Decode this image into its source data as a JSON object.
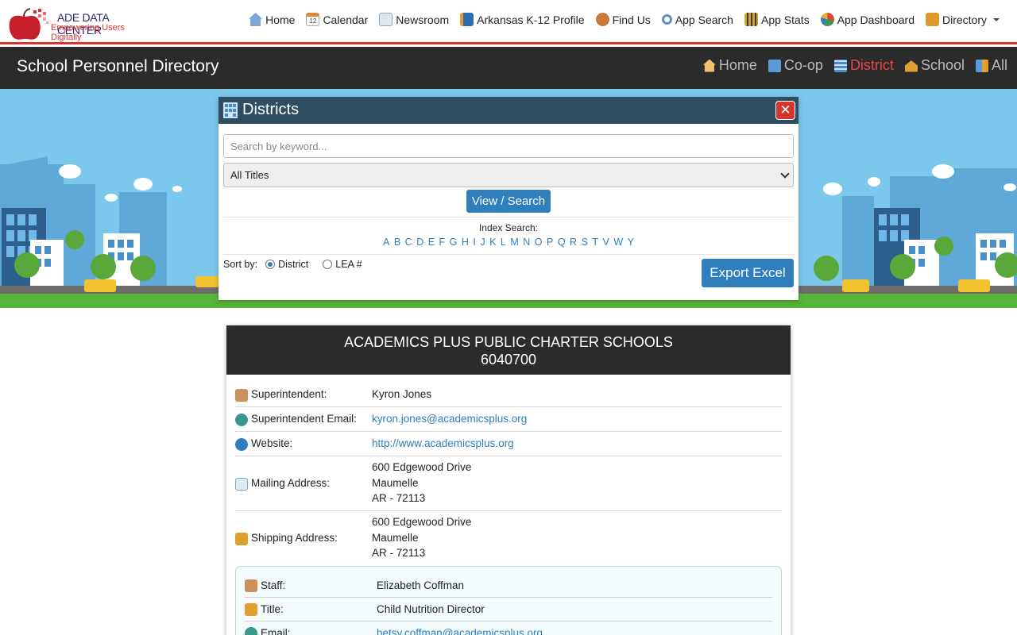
{
  "brand": {
    "title": "ADE DATA CENTER",
    "subtitle": "Empowering Users Digitally"
  },
  "topnav": [
    {
      "label": "Home",
      "icon": "house-icon",
      "color": "#7aa7d6"
    },
    {
      "label": "Calendar",
      "icon": "calendar-icon",
      "color": "#e0883a"
    },
    {
      "label": "Newsroom",
      "icon": "newspaper-icon",
      "color": "#8aa4b8"
    },
    {
      "label": "Arkansas K-12 Profile",
      "icon": "book-icon",
      "color": "#2f6fb0"
    },
    {
      "label": "Find Us",
      "icon": "person-icon",
      "color": "#c87a3a"
    },
    {
      "label": "App Search",
      "icon": "magnifier-icon",
      "color": "#5a8fc4"
    },
    {
      "label": "App Stats",
      "icon": "bar-chart-icon",
      "color": "#c9a23a"
    },
    {
      "label": "App Dashboard",
      "icon": "pie-chart-icon",
      "color": "#d94a3a"
    },
    {
      "label": "Directory",
      "icon": "address-book-icon",
      "color": "#e09a2a"
    }
  ],
  "header": {
    "title": "School Personnel Directory"
  },
  "subnav": [
    {
      "label": "Home",
      "icon": "house-icon",
      "active": false
    },
    {
      "label": "Co-op",
      "icon": "building-icon",
      "active": false
    },
    {
      "label": "District",
      "icon": "office-building-icon",
      "active": true
    },
    {
      "label": "School",
      "icon": "school-icon",
      "active": false
    },
    {
      "label": "All",
      "icon": "all-buildings-icon",
      "active": false
    }
  ],
  "modal": {
    "title": "Districts",
    "close": "✕",
    "search_placeholder": "Search by keyword...",
    "title_select_value": "All Titles",
    "view_button": "View / Search",
    "index_label": "Index Search:",
    "letters": [
      "A",
      "B",
      "C",
      "D",
      "E",
      "F",
      "G",
      "H",
      "I",
      "J",
      "K",
      "L",
      "M",
      "N",
      "O",
      "P",
      "Q",
      "R",
      "S",
      "T",
      "V",
      "W",
      "Y"
    ],
    "sort_label": "Sort by:",
    "sort_options": [
      {
        "label": "District",
        "checked": true
      },
      {
        "label": "LEA #",
        "checked": false
      }
    ],
    "export_button": "Export Excel"
  },
  "district": {
    "name": "ACADEMICS PLUS PUBLIC CHARTER SCHOOLS",
    "lea": "6040700",
    "superintendent_label": "Superintendent:",
    "superintendent": "Kyron Jones",
    "email_label": "Superintendent Email:",
    "email": "kyron.jones@academicsplus.org",
    "website_label": "Website:",
    "website": "http://www.academicsplus.org",
    "mailing_label": "Mailing Address:",
    "mailing": {
      "line1": "600 Edgewood Drive",
      "line2": "Maumelle",
      "line3": "AR - 72113"
    },
    "shipping_label": "Shipping Address:",
    "shipping": {
      "line1": "600 Edgewood Drive",
      "line2": "Maumelle",
      "line3": "AR - 72113"
    }
  },
  "staff": {
    "staff_label": "Staff:",
    "staff": "Elizabeth Coffman",
    "title_label": "Title:",
    "title": "Child Nutrition Director",
    "email_label": "Email:",
    "email": "betsy.coffman@academicsplus.org"
  }
}
